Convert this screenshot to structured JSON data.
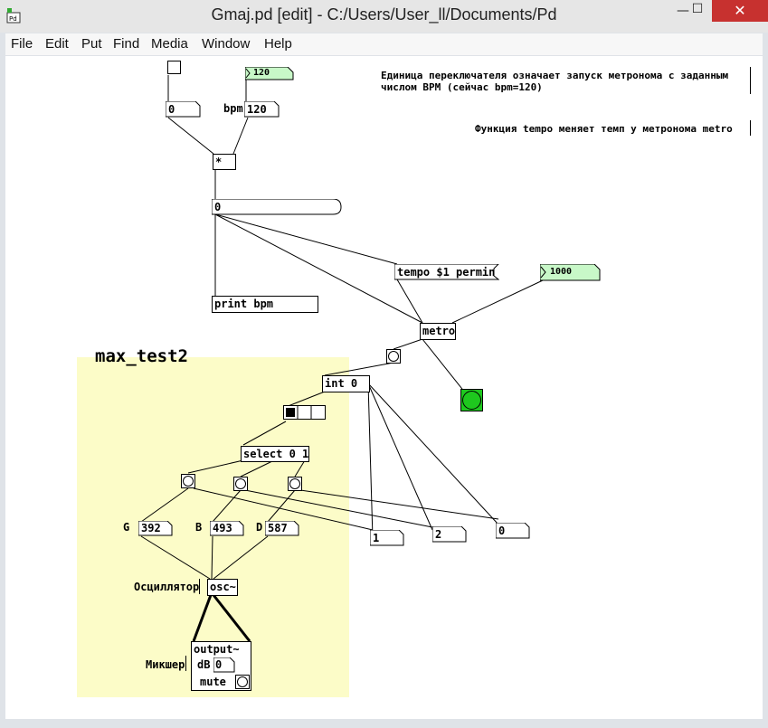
{
  "window": {
    "title": "Gmaj.pd  [edit] - C:/Users/User_ll/Documents/Pd",
    "app_icon_label": "Pd",
    "min": "—",
    "max": "☐",
    "close": "✕"
  },
  "menu": [
    "File",
    "Edit",
    "Put",
    "Find",
    "Media",
    "Window",
    "Help"
  ],
  "canvas": {
    "toggle_top_value": "",
    "num_toggle": "0",
    "bpm_label": "bpm",
    "num_bpm": "120",
    "gatom_120": "120",
    "mul": "*",
    "num_long": "0",
    "tempo_msg": "tempo $1 permin",
    "gatom_1000": "1000",
    "print": "print bpm",
    "metro": "metro",
    "comment1": "Единица переключателя означает запуск метронома с заданным\nчислом BPM (сейчас bpm=120)",
    "comment2": "Функция tempo меняет темп у метронома metro",
    "gop_title": "max_test2",
    "int": "int 0",
    "select": "select 0 1",
    "label_g": "G",
    "label_b": "B",
    "label_d": "D",
    "num_g": "392",
    "num_b": "493",
    "num_d": "587",
    "num_1": "1",
    "num_2": "2",
    "num_0": "0",
    "osc_label": "Осциллятор",
    "osc": "osc~",
    "mixer_label": "Микшер",
    "output": "output~",
    "db_label": "dB",
    "db_value": "0",
    "mute_label": "mute",
    "colors": {
      "gop_bg": "#fcfcc8",
      "gatom_bg": "#c8f8c8",
      "bang_on": "#1ec81e",
      "close_btn": "#c7312f"
    }
  }
}
